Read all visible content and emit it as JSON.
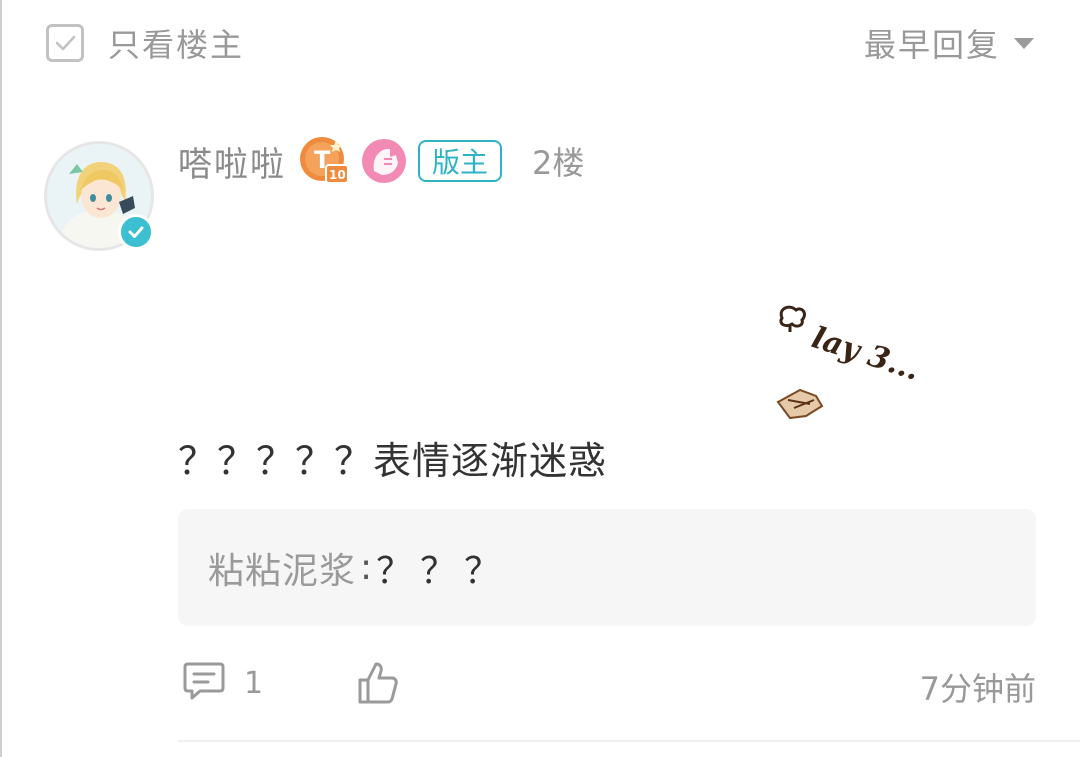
{
  "top_bar": {
    "only_op_label": "只看楼主",
    "sort_label": "最早回复"
  },
  "post": {
    "author": "嗒啦啦",
    "moderator_badge": "版主",
    "floor": "2楼",
    "content": "？？？？？表情逐渐迷惑",
    "sticker_text": "lay 3...",
    "badges": [
      "T10-level-badge",
      "pink-hand-badge"
    ],
    "verified": true,
    "reply": {
      "user": "粘粘泥浆",
      "separator": ":",
      "text": "？？？"
    },
    "comment_count": "1",
    "time": "7分钟前"
  },
  "colors": {
    "accent": "#2eb3c4",
    "verify": "#3bbfd1",
    "muted_text": "#999999",
    "body_text": "#333333",
    "reply_bg": "#f6f6f6",
    "level_badge": "#f08a3c",
    "pink_badge": "#f38ab5"
  },
  "icons": {
    "checkbox": "checkbox-icon",
    "sort_caret": "caret-down-icon",
    "verify": "verified-check-icon",
    "comment": "comment-icon",
    "like": "thumbs-up-icon"
  }
}
